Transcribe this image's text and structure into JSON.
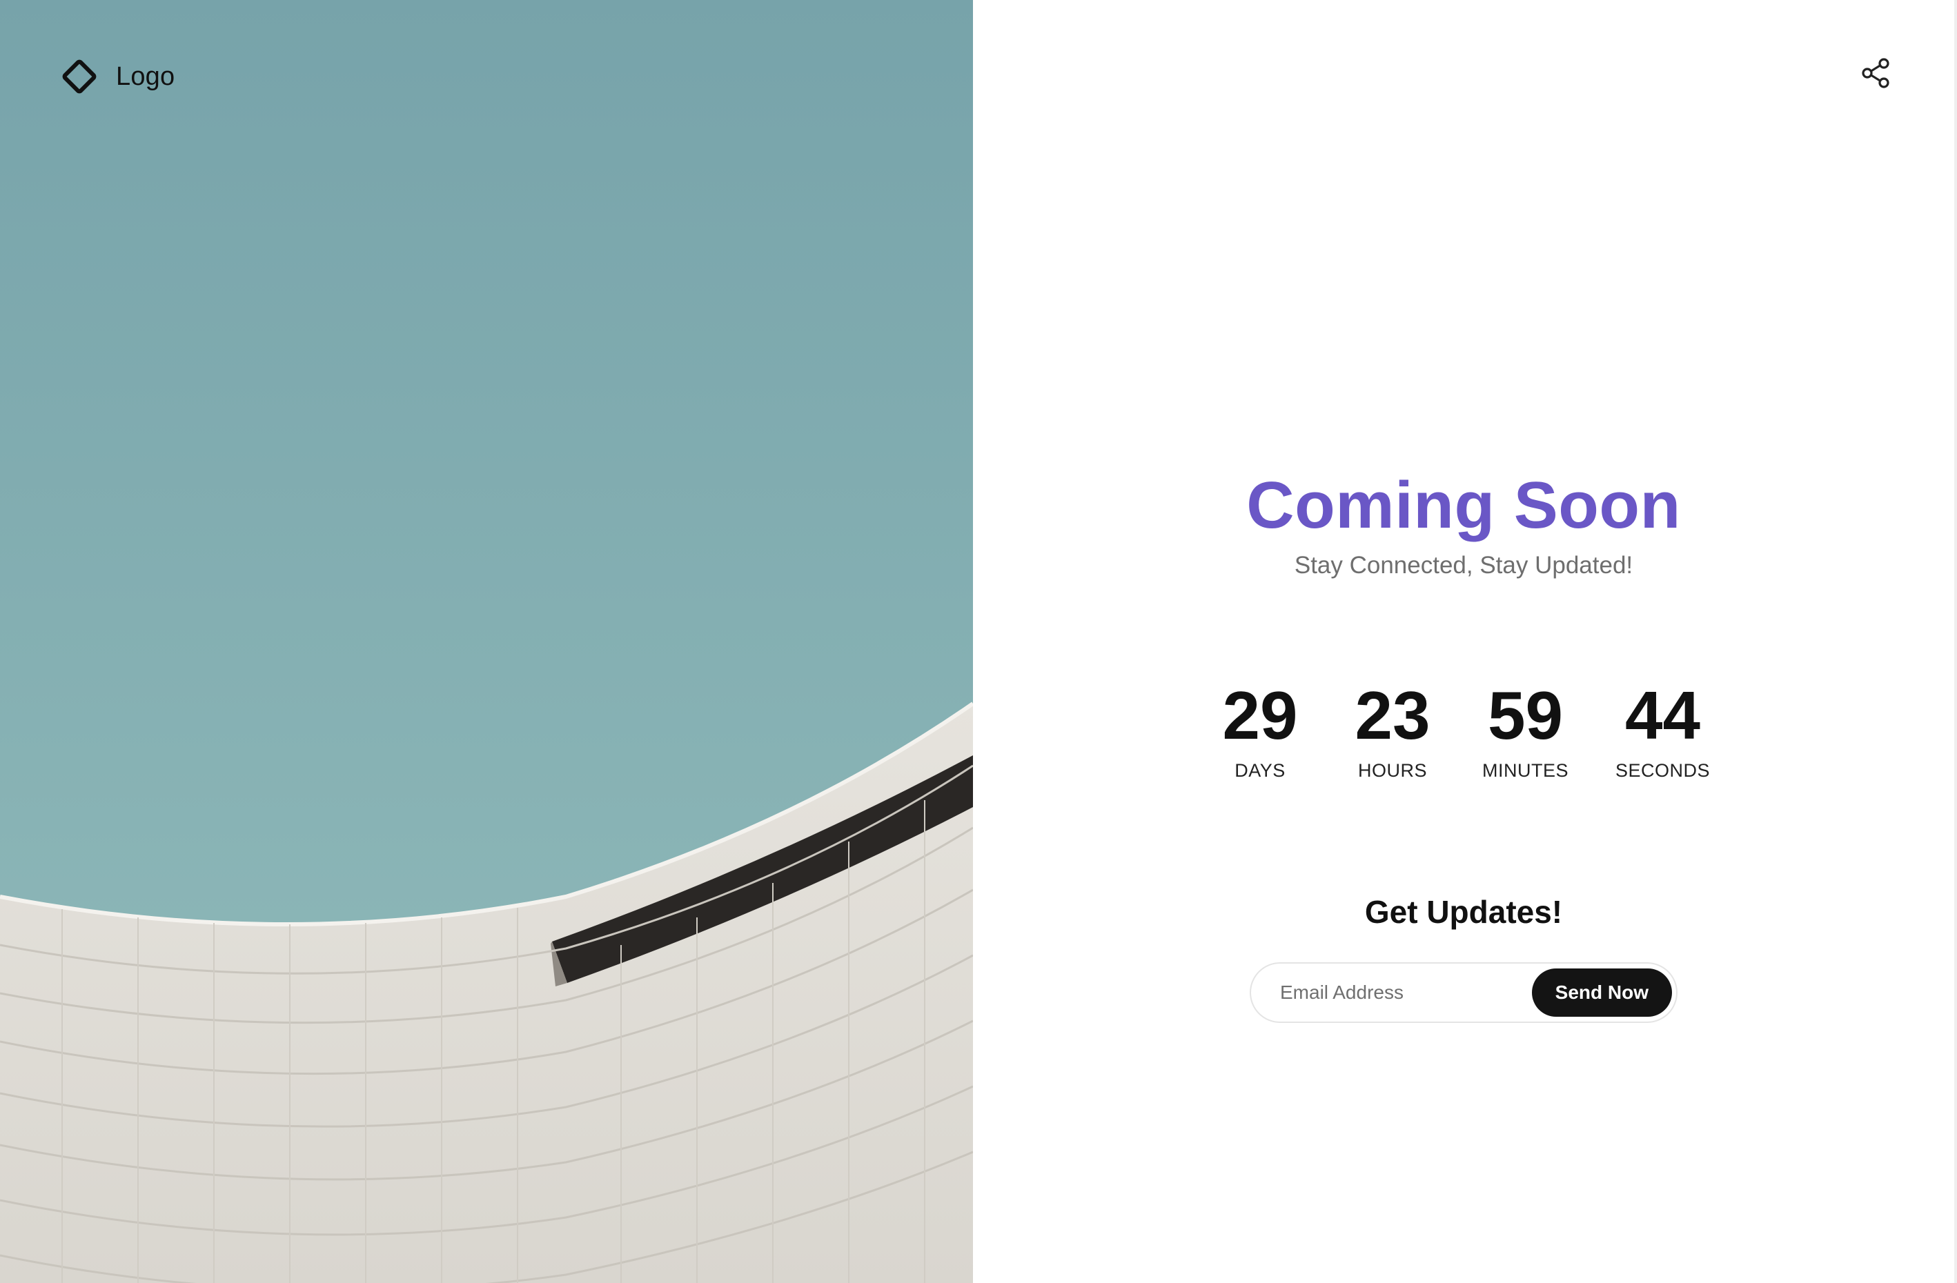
{
  "brand": {
    "label": "Logo",
    "icon": "diamond-outline-icon"
  },
  "header": {
    "share_icon": "share-icon"
  },
  "hero": {
    "title": "Coming Soon",
    "subtitle": "Stay Connected, Stay Updated!"
  },
  "countdown": {
    "days": {
      "value": "29",
      "label": "DAYS"
    },
    "hours": {
      "value": "23",
      "label": "HOURS"
    },
    "minutes": {
      "value": "59",
      "label": "MINUTES"
    },
    "seconds": {
      "value": "44",
      "label": "SECONDS"
    }
  },
  "updates": {
    "title": "Get Updates!",
    "email_placeholder": "Email Address",
    "email_value": "",
    "submit_label": "Send Now"
  },
  "colors": {
    "accent": "#6a57c6",
    "button": "#141414",
    "sky": "#7aa6ad"
  }
}
